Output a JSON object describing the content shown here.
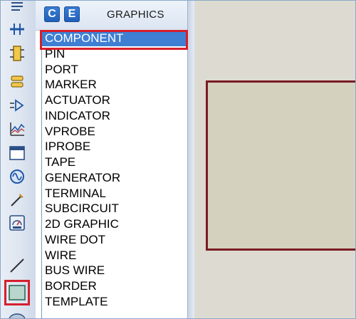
{
  "header": {
    "c_button": "C",
    "e_button": "E",
    "title": "GRAPHICS"
  },
  "toolbar": {
    "tools": [
      {
        "icon": "text-script-icon"
      },
      {
        "icon": "bus-icon"
      },
      {
        "icon": "subcircuit-icon"
      },
      {
        "icon": "terminal-icon"
      },
      {
        "icon": "device-pin-icon"
      },
      {
        "icon": "graph-icon"
      },
      {
        "icon": "tape-recorder-icon"
      },
      {
        "icon": "generator-icon"
      },
      {
        "icon": "voltage-probe-icon"
      },
      {
        "icon": "virtual-instrument-icon"
      },
      {
        "icon": "line-icon"
      },
      {
        "icon": "box-icon"
      },
      {
        "icon": "circle-icon"
      }
    ],
    "selected_tool": "box-icon"
  },
  "list": {
    "items": [
      "COMPONENT",
      "PIN",
      "PORT",
      "MARKER",
      "ACTUATOR",
      "INDICATOR",
      "VPROBE",
      "IPROBE",
      "TAPE",
      "GENERATOR",
      "TERMINAL",
      "SUBCIRCUIT",
      "2D GRAPHIC",
      "WIRE DOT",
      "WIRE",
      "BUS WIRE",
      "BORDER",
      "TEMPLATE"
    ],
    "selected": "COMPONENT"
  },
  "colors": {
    "selection": "#3e7fd3",
    "highlight": "#d61f2c",
    "canvas": "#dddbd1",
    "shape_fill": "#d4d2bf",
    "shape_border": "#7b1a23"
  }
}
